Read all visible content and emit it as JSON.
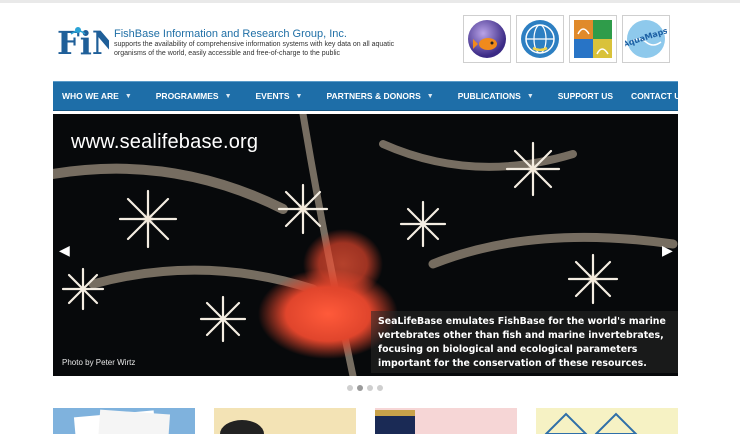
{
  "header": {
    "logo_text": "FiN",
    "org_name": "FishBase Information and Research Group, Inc.",
    "tagline": "supports the availability of comprehensive information systems with key data on all aquatic organisms of the world, easily accessible and free-of-charge to the public",
    "partner_logos": [
      {
        "icon": "fish-sphere-icon"
      },
      {
        "icon": "globe-emblem-icon"
      },
      {
        "icon": "sealifebase-logo-icon"
      },
      {
        "icon": "aquamaps-logo-icon",
        "text": "AquaMaps"
      }
    ]
  },
  "nav": {
    "items": [
      {
        "label": "WHO WE ARE",
        "dropdown": true
      },
      {
        "label": "PROGRAMMES",
        "dropdown": true
      },
      {
        "label": "EVENTS",
        "dropdown": true
      },
      {
        "label": "PARTNERS & DONORS",
        "dropdown": true
      },
      {
        "label": "PUBLICATIONS",
        "dropdown": true
      },
      {
        "label": "SUPPORT US",
        "dropdown": false
      },
      {
        "label": "CONTACT US",
        "dropdown": false
      }
    ],
    "color": "#1e6ea8"
  },
  "slider": {
    "url": "www.sealifebase.org",
    "caption": "SeaLifeBase emulates FishBase for the world's marine vertebrates other than fish and marine invertebrates, focusing on biological and ecological parameters important for the conservation of these resources.",
    "credit": "Photo by Peter Wirtz",
    "prev_icon": "chevron-left-icon",
    "next_icon": "chevron-right-icon",
    "slide_count": 4,
    "active_index": 1
  }
}
